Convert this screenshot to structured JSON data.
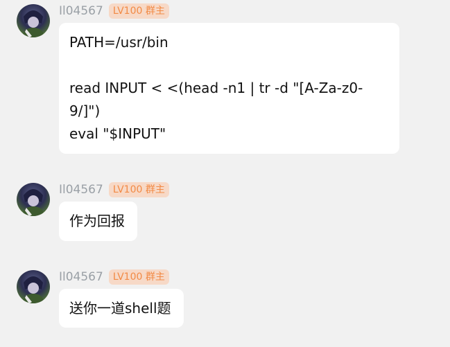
{
  "messages": [
    {
      "username": "Il04567",
      "badge": "LV100 群主",
      "lines": [
        "PATH=/usr/bin",
        "",
        "read INPUT < <(head -n1 | tr -d \"[A-Za-z0-",
        "9/]\")",
        "eval \"$INPUT\""
      ]
    },
    {
      "username": "Il04567",
      "badge": "LV100 群主",
      "lines": [
        "作为回报"
      ]
    },
    {
      "username": "Il04567",
      "badge": "LV100 群主",
      "lines": [
        "送你一道shell题"
      ]
    }
  ],
  "icons": {
    "avatar": "anime-character-avatar"
  },
  "colors": {
    "background": "#f1f1f1",
    "bubble": "#ffffff",
    "username": "#9aa0a6",
    "badge_bg": "#f7d9c7",
    "badge_text": "#f28a45"
  }
}
